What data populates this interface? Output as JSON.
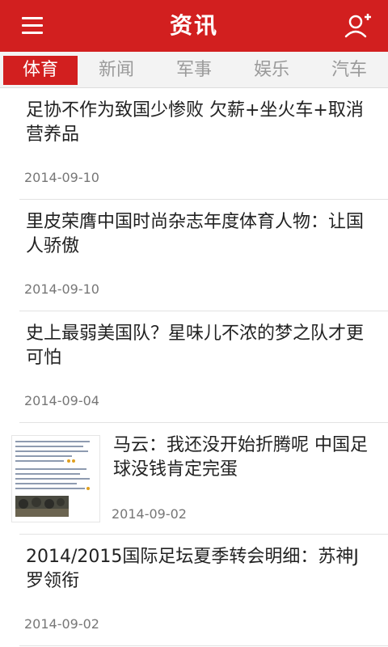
{
  "header": {
    "title": "资讯",
    "menu_icon": "menu-icon",
    "user_icon": "user-add-icon",
    "brand_color": "#d21f1f"
  },
  "tabs": [
    {
      "label": "体育",
      "active": true
    },
    {
      "label": "新闻",
      "active": false
    },
    {
      "label": "军事",
      "active": false
    },
    {
      "label": "娱乐",
      "active": false
    },
    {
      "label": "汽车",
      "active": false
    }
  ],
  "articles": [
    {
      "title": "足协不作为致国少惨败 欠薪+坐火车+取消营养品",
      "date": "2014-09-10"
    },
    {
      "title": "里皮荣膺中国时尚杂志年度体育人物：让国人骄傲",
      "date": "2014-09-10"
    },
    {
      "title": "史上最弱美国队？星味儿不浓的梦之队才更可怕",
      "date": "2014-09-04"
    },
    {
      "title": "马云：我还没开始折腾呢 中国足球没钱肯定完蛋",
      "date": "2014-09-02",
      "has_thumbnail": true
    },
    {
      "title": "2014/2015国际足坛夏季转会明细：苏神J罗领衔",
      "date": "2014-09-02"
    }
  ]
}
